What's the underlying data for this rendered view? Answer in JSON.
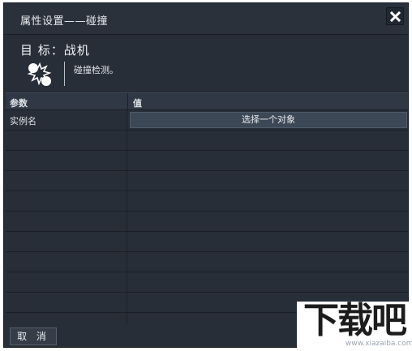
{
  "window": {
    "title": "属性设置——碰撞",
    "close_icon": "close-icon"
  },
  "target": {
    "label": "目  标：战机"
  },
  "behavior": {
    "icon": "collision-icon",
    "description": "碰撞检测。"
  },
  "grid": {
    "headers": [
      "参数",
      "值"
    ],
    "rows": [
      {
        "param": "实例名",
        "value_button": "选择一个对象"
      }
    ]
  },
  "footer": {
    "cancel_label": "取 消"
  },
  "watermark": {
    "text": "下载吧",
    "url": "www.xiazaiba.com"
  },
  "colors": {
    "background": "#272e38",
    "header": "#2f3844",
    "button": "#3d4856",
    "text": "#e0e4e8"
  }
}
